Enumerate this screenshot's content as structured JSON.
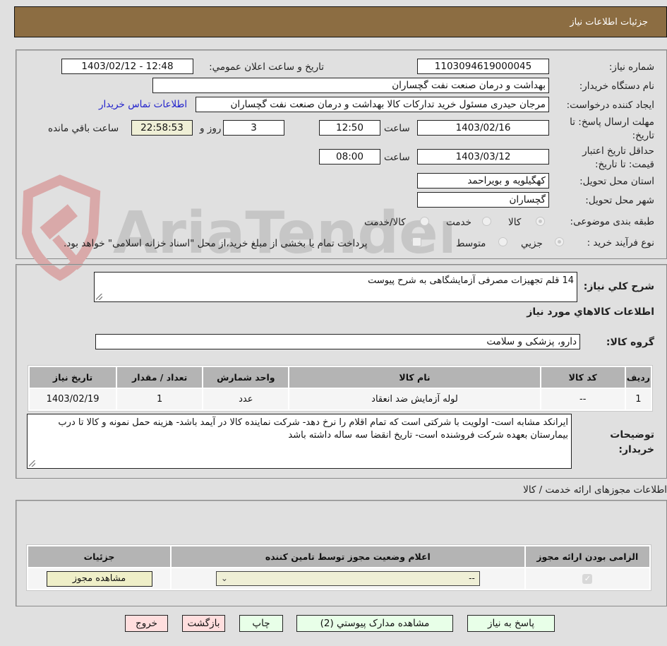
{
  "header": {
    "title": "جزئیات اطلاعات نیاز"
  },
  "form": {
    "need_number": {
      "label": "شماره نیاز:",
      "value": "1103094619000045"
    },
    "announce": {
      "label": "تاريخ و ساعت اعلان عمومي:",
      "value": "1403/02/12 - 12:48"
    },
    "buyer_org": {
      "label": "نام دستگاه خریدار:",
      "value": "بهداشت و درمان صنعت نفت گچساران"
    },
    "requester": {
      "label": "ایجاد کننده درخواست:",
      "value": "مرجان  حیدری مسئول خرید تدارکات کالا  بهداشت و درمان صنعت نفت گچساران",
      "contact_link": "اطلاعات تماس خریدار"
    },
    "deadline": {
      "label": "مهلت ارسال پاسخ: تا تاریخ:",
      "date": "1403/02/16",
      "time_label": "ساعت",
      "time": "12:50",
      "days": "3",
      "days_label": "روز و",
      "remaining": "22:58:53",
      "remaining_label": "ساعت باقي مانده"
    },
    "validity": {
      "label": "حداقل تاریخ اعتبار قیمت: تا تاریخ:",
      "date": "1403/03/12",
      "time_label": "ساعت",
      "time": "08:00"
    },
    "province": {
      "label": "استان محل تحویل:",
      "value": "کهگیلویه و بویراحمد"
    },
    "city": {
      "label": "شهر محل تحویل:",
      "value": "گچساران"
    },
    "category": {
      "label": "طبقه بندی موضوعی:",
      "options": [
        {
          "label": "کالا",
          "selected": true
        },
        {
          "label": "خدمت",
          "selected": false
        },
        {
          "label": "کالا/خدمت",
          "selected": false
        }
      ]
    },
    "process": {
      "label": "نوع فرآیند خرید :",
      "options": [
        {
          "label": "جزيي",
          "selected": true
        },
        {
          "label": "متوسط",
          "selected": false
        }
      ],
      "treasury_checkbox": {
        "label": "پرداخت تمام یا بخشی از مبلغ خرید،از محل \"اسناد خزانه اسلامی\" خواهد بود.",
        "checked": false
      }
    }
  },
  "details": {
    "summary_label": "شرح کلي نیاز:",
    "summary_value": "14 قلم تجهیزات مصرفی آزمایشگاهی به شرح پیوست",
    "goods_info_title": "اطلاعات کالاهاي مورد نیاز",
    "goods_group_label": "گروه کالا:",
    "goods_group_value": "دارو، پزشکی و سلامت",
    "table": {
      "columns": [
        "ردیف",
        "کد کالا",
        "نام کالا",
        "واحد شمارش",
        "تعداد / مقدار",
        "تاریخ نیاز"
      ],
      "rows": [
        [
          "1",
          "--",
          "لوله آزمایش ضد انعقاد",
          "عدد",
          "1",
          "1403/02/19"
        ]
      ]
    },
    "buyer_notes_label": "توضیحات خریدار:",
    "buyer_notes_value": "ایرانکد مشابه است- اولویت با شرکتی است که تمام اقلام را نرخ دهد- شرکت نماینده کالا در آیمد باشد- هزینه حمل نمونه و کالا تا درب بیمارستان بعهده شرکت فروشنده است- تاریخ انقضا سه ساله داشته باشد"
  },
  "permits": {
    "title": "اطلاعات مجوزهای ارائه خدمت / کالا",
    "columns": [
      "الزامی بودن ارائه مجوز",
      "اعلام وضعیت مجوز توسط تامین کننده",
      "جزئیات"
    ],
    "row": {
      "required_checked": true,
      "status_value": "--",
      "details_button": "مشاهده مجوز"
    }
  },
  "actions": {
    "reply": "پاسخ به نیاز",
    "attachments": "مشاهده مدارک پیوستي (2)",
    "print": "چاپ",
    "back": "بازگشت",
    "exit": "خروج"
  },
  "watermark": {
    "text": "AriaTender.neT"
  }
}
